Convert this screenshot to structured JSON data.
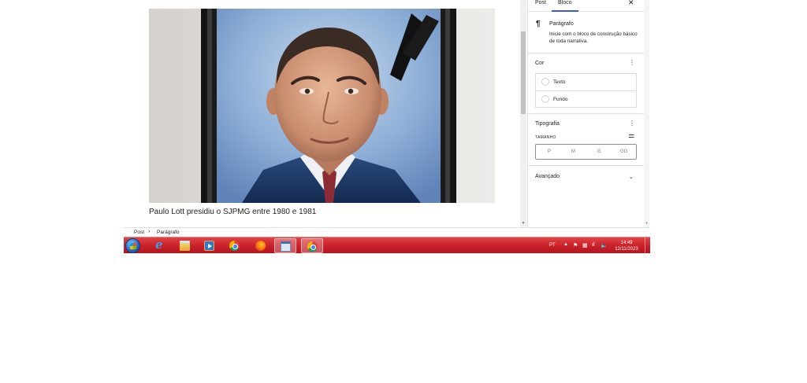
{
  "editor": {
    "image_alt": "Retrato de Paulo Lott",
    "caption": "Paulo Lott presidiu o SJPMG entre 1980 e 1981"
  },
  "sidebar": {
    "tabs": {
      "post": "Post",
      "bloco": "Bloco"
    },
    "close_glyph": "✕",
    "block": {
      "icon": "pilcrow-icon",
      "icon_glyph": "¶",
      "title": "Parágrafo",
      "description": "Inicie com o bloco de construção básico de toda narrativa."
    },
    "color": {
      "title": "Cor",
      "items": [
        {
          "label": "Texto"
        },
        {
          "label": "Fundo"
        }
      ]
    },
    "typography": {
      "title": "Tipografia",
      "size_label": "TAMANHO",
      "sizes": [
        "P",
        "M",
        "G",
        "GG"
      ]
    },
    "advanced": {
      "title": "Avançado"
    },
    "more_glyph": "⋮",
    "sliders_glyph": "⚌",
    "chevron_glyph": "⌄"
  },
  "breadcrumb": {
    "items": [
      "Post",
      "Parágrafo"
    ],
    "separator": "›"
  },
  "taskbar": {
    "apps": [
      {
        "name": "internet-explorer",
        "icon": "ie-icon",
        "glyph": "e",
        "active": false
      },
      {
        "name": "windows-explorer",
        "icon": "folder-icon",
        "active": false
      },
      {
        "name": "media-player",
        "icon": "media-player-icon",
        "active": false
      },
      {
        "name": "google-chrome",
        "icon": "chrome-icon",
        "active": false
      },
      {
        "name": "firefox",
        "icon": "firefox-icon",
        "active": false
      },
      {
        "name": "window",
        "icon": "window-icon",
        "active": true
      },
      {
        "name": "google-chrome-2",
        "icon": "chrome-icon",
        "active": true
      }
    ],
    "tray": {
      "language": "PT",
      "arrow_glyph": "▲",
      "flag_glyph": "⚑",
      "network_glyph": "▦",
      "signal_glyph": "ıl",
      "volume_glyph": "🔈",
      "time": "14:49",
      "date": "12/11/2023"
    }
  },
  "colors": {
    "accent": "#3858e9",
    "taskbar": "#c8202a",
    "suit": "#1f3a66",
    "portrait_background": "#8fb0d8"
  }
}
